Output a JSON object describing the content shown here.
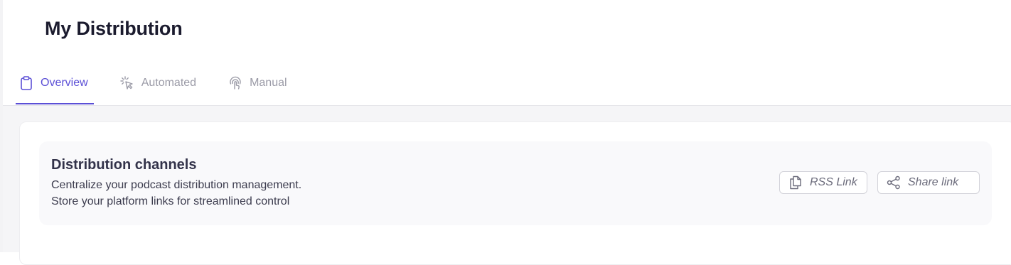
{
  "page": {
    "title": "My Distribution"
  },
  "tabs": [
    {
      "label": "Overview",
      "icon": "clipboard-icon",
      "active": true
    },
    {
      "label": "Automated",
      "icon": "cursor-click-icon",
      "active": false
    },
    {
      "label": "Manual",
      "icon": "touch-pointer-icon",
      "active": false
    }
  ],
  "distribution_card": {
    "title": "Distribution channels",
    "description_line1": "Centralize your podcast distribution management.",
    "description_line2": "Store your platform links for streamlined control",
    "rss_button_label": "RSS Link",
    "rss_button_icon": "copy-icon",
    "share_button_label": "Share link",
    "share_button_icon": "share-icon"
  },
  "colors": {
    "accent": "#5b4fd6",
    "tab_inactive": "#9b9ba7",
    "title": "#1b1b2e",
    "card_background": "#f9f9fb"
  }
}
